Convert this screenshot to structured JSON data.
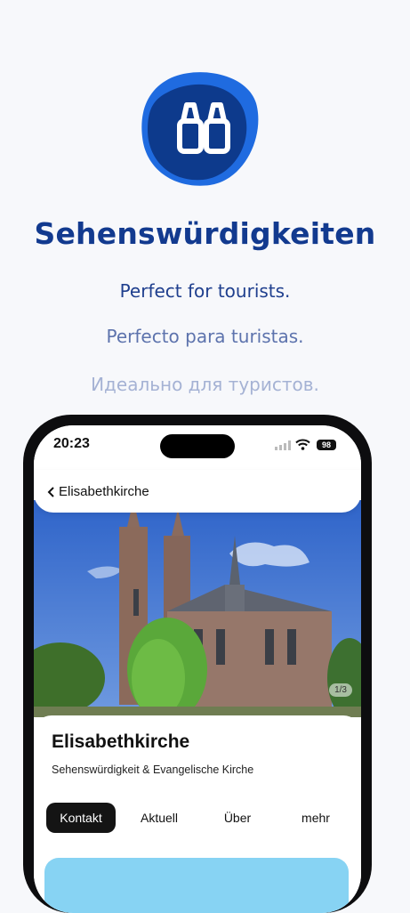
{
  "headline": "Sehenswürdigkeiten",
  "taglines": {
    "en": "Perfect for tourists.",
    "es": "Perfecto para turistas.",
    "ru": "Идеально для туристов."
  },
  "logo": {
    "icon": "binoculars-icon",
    "colors": [
      "#1f6be0",
      "#0d3a8c"
    ]
  },
  "phone": {
    "status_bar": {
      "time": "20:23",
      "battery": "98"
    },
    "nav": {
      "back_label": "Elisabethkirche"
    },
    "image_pager": "1/3",
    "place": {
      "name": "Elisabethkirche",
      "category": "Sehenswürdigkeit & Evangelische Kirche"
    },
    "tabs": [
      "Kontakt",
      "Aktuell",
      "Über",
      "mehr"
    ],
    "active_tab": "Kontakt"
  },
  "colors": {
    "brand": "#123a8f",
    "accent_box": "#87d3f3"
  }
}
